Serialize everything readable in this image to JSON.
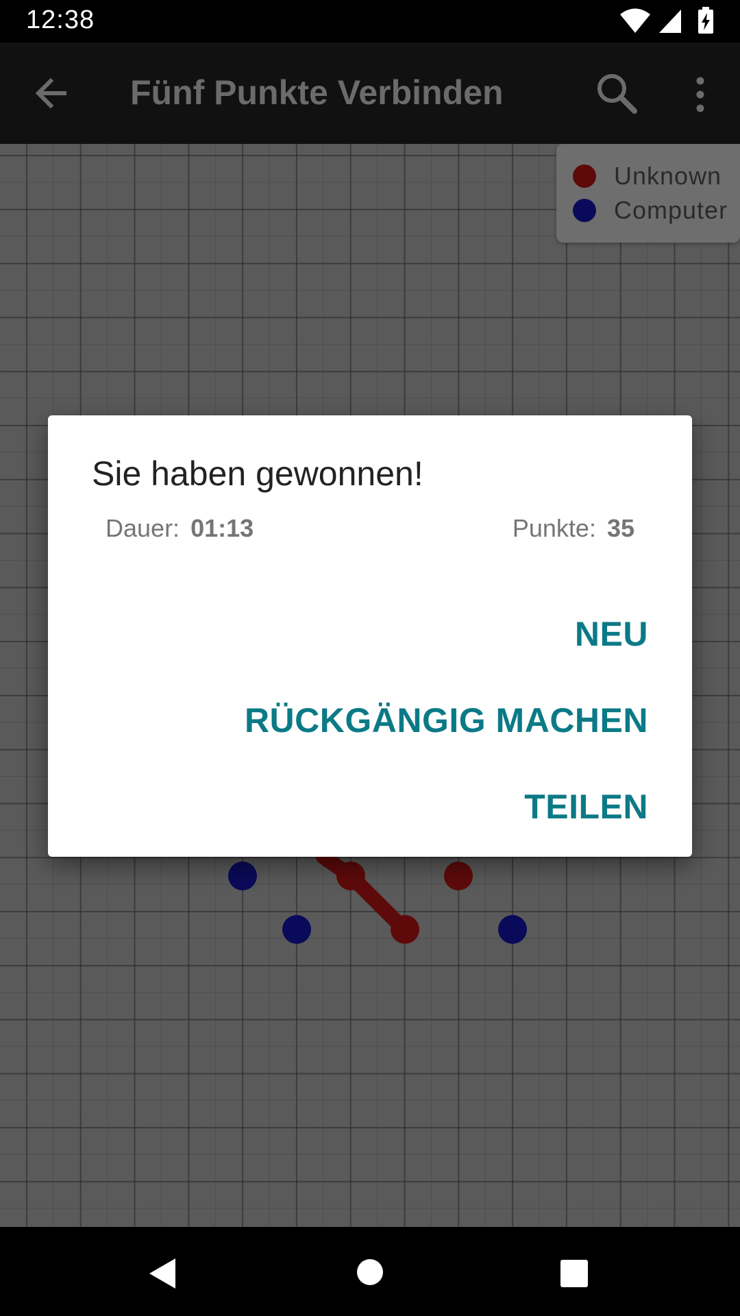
{
  "status_bar": {
    "time": "12:38",
    "icons": [
      "wifi-icon",
      "cell-signal-icon",
      "battery-charging-icon"
    ]
  },
  "app_bar": {
    "title": "Fünf Punkte Verbinden",
    "icons": [
      "back-arrow-icon",
      "search-icon",
      "more-vert-icon"
    ]
  },
  "legend": {
    "items": [
      {
        "label": "Unknown",
        "color": "#8b0000"
      },
      {
        "label": "Computer",
        "color": "#0a0a8a"
      }
    ]
  },
  "dialog": {
    "title": "Sie haben gewonnen!",
    "duration_label": "Dauer:",
    "duration_value": "01:13",
    "points_label": "Punkte:",
    "points_value": "35",
    "buttons": {
      "new": "NEU",
      "undo": "RÜCKGÄNGIG MACHEN",
      "share": "TEILEN"
    }
  },
  "colors": {
    "accent": "#0b7a86",
    "player_red": "#8b0000",
    "computer_blue": "#0a0a8a"
  },
  "nav_bar": {
    "icons": [
      "back-triangle-icon",
      "home-circle-icon",
      "recents-square-icon"
    ]
  }
}
